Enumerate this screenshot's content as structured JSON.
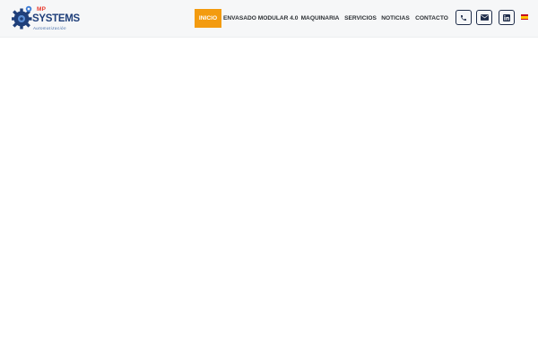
{
  "header": {
    "logo": {
      "brand_top": "MP",
      "brand_main": "SYSTEMS",
      "brand_sub": "Automatización",
      "icon": "gear-logo-icon"
    },
    "nav": [
      {
        "label": "INICIO",
        "active": true
      },
      {
        "label": "ENVASADO MODULAR 4.0",
        "active": false
      },
      {
        "label": "MAQUINARIA",
        "active": false
      },
      {
        "label": "SERVICIOS",
        "active": false
      },
      {
        "label": "NOTICIAS",
        "active": false
      },
      {
        "label": "CONTACTO",
        "active": false
      }
    ],
    "icons": [
      "phone-icon",
      "envelope-icon",
      "linkedin-icon",
      "spain-flag-icon"
    ],
    "colors": {
      "accent": "#f39b0f",
      "navy": "#1f2d4a",
      "brand_red": "#e8382c",
      "brand_blue": "#1f3f7a"
    }
  }
}
